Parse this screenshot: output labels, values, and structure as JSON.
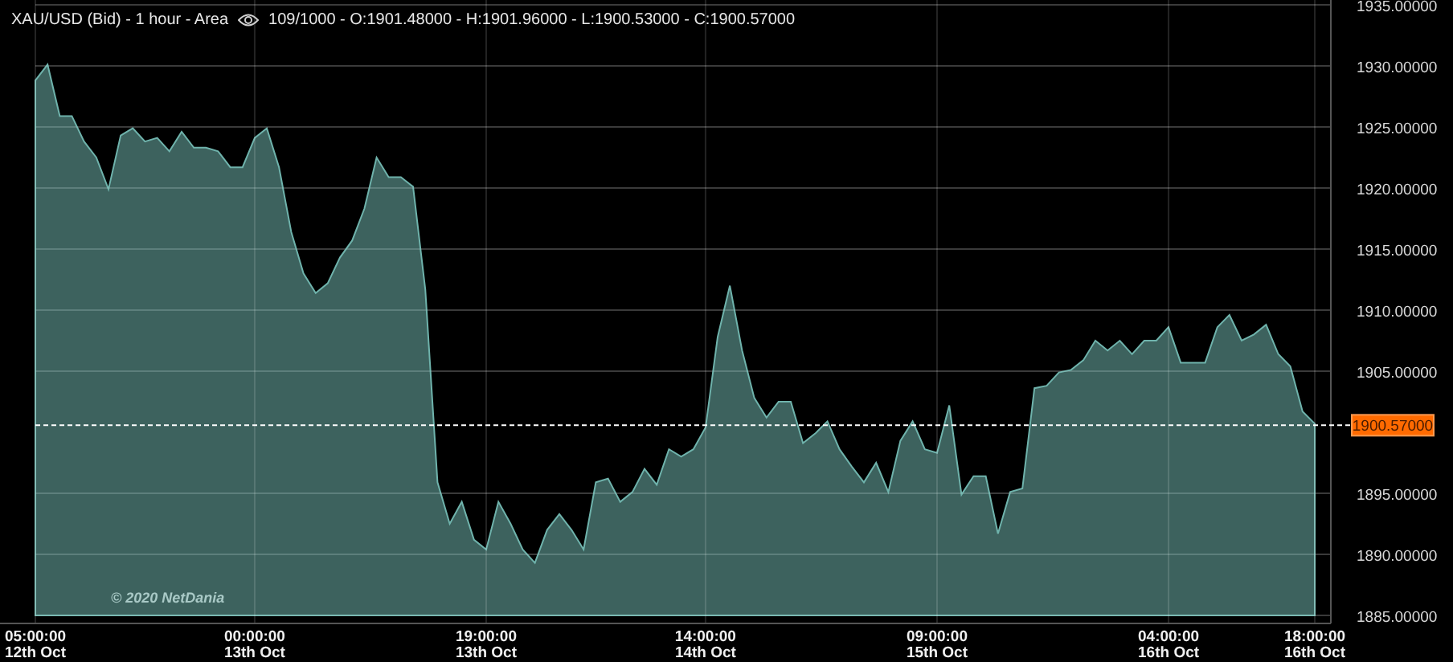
{
  "header": {
    "title": "XAU/USD (Bid) - 1 hour - Area",
    "stats": "109/1000 - O:1901.48000 - H:1901.96000 - L:1900.53000 - C:1900.57000"
  },
  "copyright": "© 2020 NetDania",
  "chart_data": {
    "type": "area",
    "grid": true,
    "categories": [
      "05:00:00\n12th Oct",
      null,
      null,
      null,
      null,
      null,
      null,
      null,
      null,
      null,
      null,
      null,
      null,
      null,
      null,
      null,
      null,
      null,
      "00:00:00\n13th Oct",
      null,
      null,
      null,
      null,
      null,
      null,
      null,
      null,
      null,
      null,
      null,
      null,
      null,
      null,
      null,
      null,
      null,
      null,
      "19:00:00\n13th Oct",
      null,
      null,
      null,
      null,
      null,
      null,
      null,
      null,
      null,
      null,
      null,
      null,
      null,
      null,
      null,
      null,
      null,
      "14:00:00\n14th Oct",
      null,
      null,
      null,
      null,
      null,
      null,
      null,
      null,
      null,
      null,
      null,
      null,
      null,
      null,
      null,
      null,
      null,
      null,
      "09:00:00\n15th Oct",
      null,
      null,
      null,
      null,
      null,
      null,
      null,
      null,
      null,
      null,
      null,
      null,
      null,
      null,
      null,
      null,
      null,
      null,
      "04:00:00\n16th Oct",
      null,
      null,
      null,
      null,
      null,
      null,
      null,
      null,
      null,
      null,
      null,
      "18:00:00\n16th Oct"
    ],
    "series": [
      {
        "color": "#6fb3ac",
        "values": [
          1928.8,
          1930.1,
          1925.9,
          1925.9,
          1923.8,
          1922.5,
          1919.9,
          1924.3,
          1924.9,
          1923.8,
          1924.1,
          1923.0,
          1924.6,
          1923.3,
          1923.3,
          1923.0,
          1921.7,
          1921.7,
          1924.1,
          1924.9,
          1921.7,
          1916.4,
          1913.0,
          1911.4,
          1912.2,
          1914.3,
          1915.7,
          1918.3,
          1922.5,
          1920.9,
          1920.9,
          1920.1,
          1911.7,
          1895.9,
          1892.5,
          1894.3,
          1891.2,
          1890.4,
          1894.3,
          1892.5,
          1890.4,
          1889.3,
          1892.0,
          1893.3,
          1892.0,
          1890.4,
          1895.9,
          1896.2,
          1894.3,
          1895.1,
          1897.0,
          1895.7,
          1898.6,
          1898.0,
          1898.6,
          1900.4,
          1907.8,
          1912.0,
          1906.7,
          1902.8,
          1901.2,
          1902.5,
          1902.5,
          1899.1,
          1899.9,
          1900.9,
          1898.6,
          1897.2,
          1895.9,
          1897.5,
          1895.1,
          1899.3,
          1900.9,
          1898.6,
          1898.3,
          1902.2,
          1894.9,
          1896.4,
          1896.4,
          1891.7,
          1895.1,
          1895.4,
          1903.6,
          1903.8,
          1904.9,
          1905.1,
          1905.9,
          1907.5,
          1906.7,
          1907.5,
          1906.4,
          1907.5,
          1907.5,
          1908.6,
          1905.7,
          1905.7,
          1905.7,
          1908.6,
          1909.6,
          1907.5,
          1908.0,
          1908.8,
          1906.4,
          1905.4,
          1901.7,
          1900.7
        ]
      }
    ],
    "ylim": [
      1885,
      1935
    ],
    "yticks": [
      {
        "value": 1935,
        "label": "1935.00000"
      },
      {
        "value": 1930,
        "label": "1930.00000"
      },
      {
        "value": 1925,
        "label": "1925.00000"
      },
      {
        "value": 1920,
        "label": "1920.00000"
      },
      {
        "value": 1915,
        "label": "1915.00000"
      },
      {
        "value": 1910,
        "label": "1910.00000"
      },
      {
        "value": 1905,
        "label": "1905.00000"
      },
      {
        "value": 1895,
        "label": "1895.00000"
      },
      {
        "value": 1890,
        "label": "1890.00000"
      },
      {
        "value": 1885,
        "label": "1885.00000"
      }
    ],
    "ref_lines": [
      {
        "axis": "y",
        "value": 1900.57,
        "label": "1900.57000",
        "color": "#ffffff"
      }
    ]
  }
}
